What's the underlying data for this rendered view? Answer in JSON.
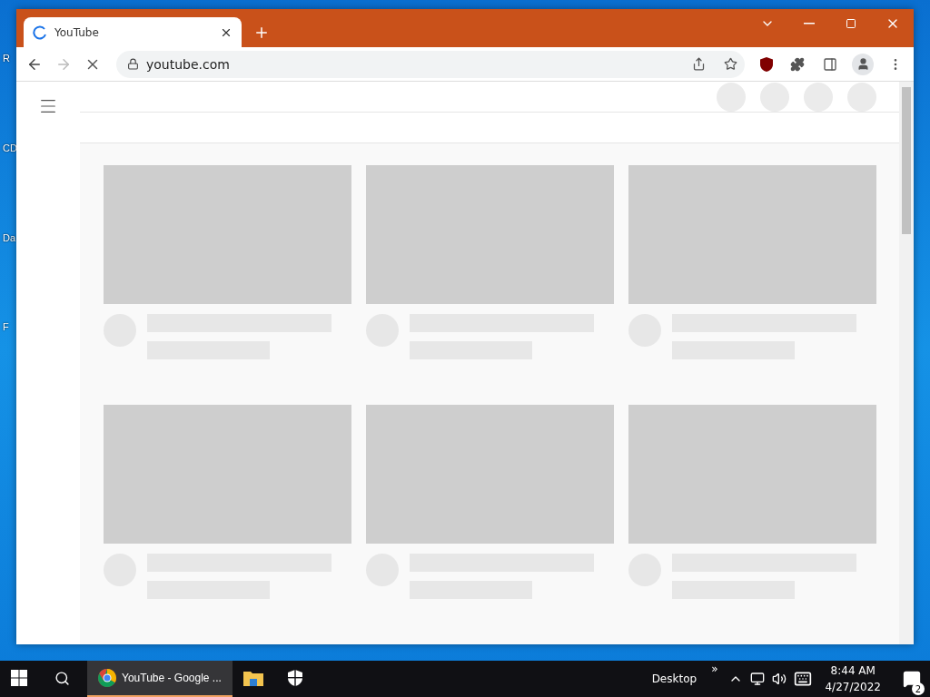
{
  "desktop_icons": [
    {
      "label": "R"
    },
    {
      "label": "CD"
    },
    {
      "label": "Da"
    },
    {
      "label": "F"
    }
  ],
  "browser": {
    "tab": {
      "title": "YouTube",
      "loading": true
    },
    "nav": {
      "back_disabled": false,
      "forward_disabled": true,
      "loading": true
    },
    "address": "youtube.com",
    "page": {
      "header_icons": [
        {
          "kind": "placeholder"
        },
        {
          "kind": "placeholder"
        },
        {
          "kind": "placeholder"
        },
        {
          "kind": "placeholder"
        }
      ],
      "cards": [
        {
          "kind": "skeleton"
        },
        {
          "kind": "skeleton"
        },
        {
          "kind": "skeleton"
        },
        {
          "kind": "skeleton"
        },
        {
          "kind": "skeleton"
        },
        {
          "kind": "skeleton"
        }
      ]
    }
  },
  "taskbar": {
    "apps": [
      {
        "kind": "chrome",
        "label": "YouTube - Google ...",
        "selected": true
      },
      {
        "kind": "explorer",
        "selected": false
      },
      {
        "kind": "security",
        "selected": false
      }
    ],
    "toolbar_label": "Desktop",
    "toolbar_chevron": "»",
    "time": "8:44 AM",
    "date": "4/27/2022",
    "notifications": "2"
  }
}
